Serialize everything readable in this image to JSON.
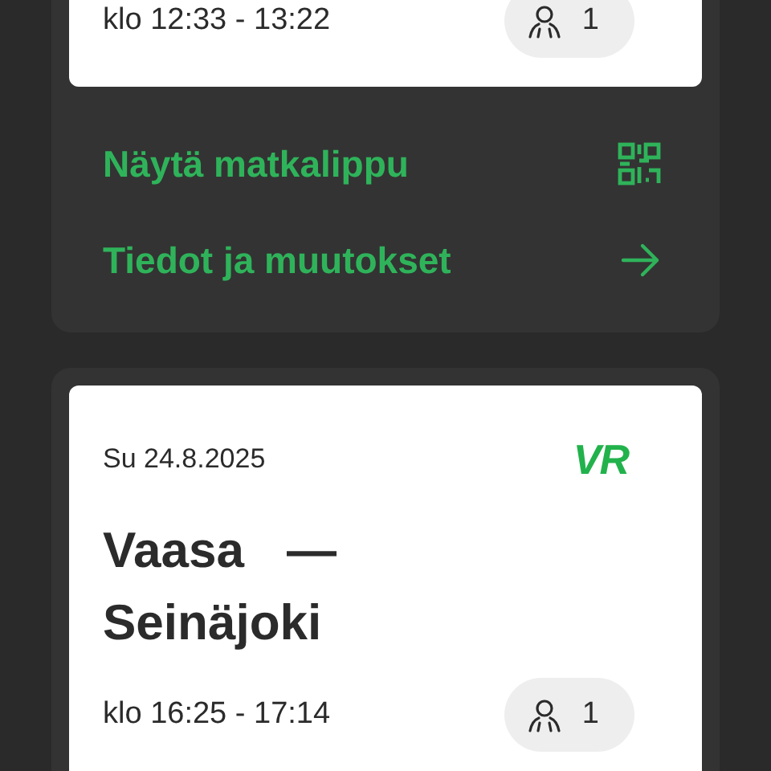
{
  "trips": [
    {
      "time": "klo 12:33 - 13:22",
      "passengers": "1",
      "actions": [
        {
          "label": "Näytä matkalippu",
          "kind": "qr"
        },
        {
          "label": "Tiedot ja muutokset",
          "kind": "arrow"
        }
      ]
    },
    {
      "date": "Su 24.8.2025",
      "logo": "VR",
      "route": "Vaasa — Seinäjoki",
      "time": "klo 16:25 - 17:14",
      "passengers": "1"
    }
  ]
}
